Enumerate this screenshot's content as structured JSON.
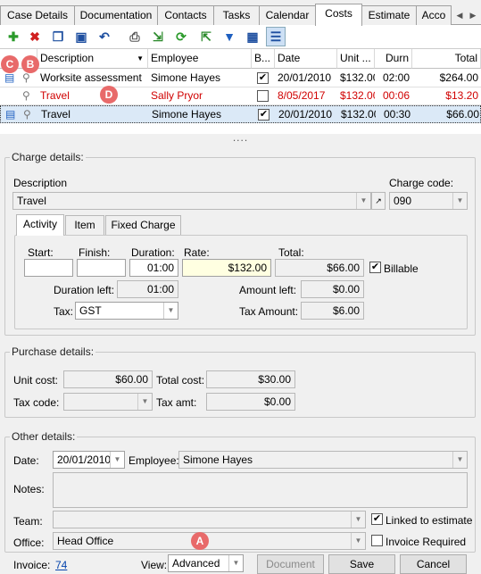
{
  "tabs": [
    "Case Details",
    "Documentation",
    "Contacts",
    "Tasks",
    "Calendar",
    "Costs",
    "Estimate",
    "Acco"
  ],
  "active_tab": "Costs",
  "toolbar": [
    "add-icon",
    "delete-icon",
    "copy-icon",
    "save-icon",
    "undo-icon",
    "print-icon",
    "export-icon",
    "refresh-icon",
    "import-icon",
    "filter-icon",
    "columns-icon",
    "layout-icon"
  ],
  "grid": {
    "headers": {
      "description": "Description",
      "employee": "Employee",
      "billable": "B...",
      "date": "Date",
      "unit": "Unit ...",
      "durn": "Durn",
      "total": "Total"
    },
    "rows": [
      {
        "description": "Worksite assessment",
        "employee": "Simone Hayes",
        "billable": true,
        "date": "20/01/2010",
        "unit": "$132.00",
        "durn": "02:00",
        "total": "$264.00",
        "red": false,
        "selected": false
      },
      {
        "description": "Travel",
        "employee": "Sally Pryor",
        "billable": false,
        "date": "8/05/2017",
        "unit": "$132.00",
        "durn": "00:06",
        "total": "$13.20",
        "red": true,
        "selected": false
      },
      {
        "description": "Travel",
        "employee": "Simone Hayes",
        "billable": true,
        "date": "20/01/2010",
        "unit": "$132.00",
        "durn": "00:30",
        "total": "$66.00",
        "red": false,
        "selected": true
      }
    ]
  },
  "badges": {
    "a": "A",
    "b": "B",
    "c": "C",
    "d": "D"
  },
  "splitter": "....",
  "charge": {
    "group_label": "Charge details:",
    "description_label": "Description",
    "description_value": "Travel",
    "charge_code_label": "Charge code:",
    "charge_code_value": "090",
    "inner_tabs": [
      "Activity",
      "Item",
      "Fixed Charge"
    ],
    "start_label": "Start:",
    "finish_label": "Finish:",
    "duration_label": "Duration:",
    "rate_label": "Rate:",
    "total_label": "Total:",
    "start_value": "",
    "finish_value": "",
    "duration_value": "01:00",
    "rate_value": "$132.00",
    "total_value": "$66.00",
    "billable_label": "Billable",
    "billable": true,
    "duration_left_label": "Duration left:",
    "duration_left_value": "01:00",
    "amount_left_label": "Amount left:",
    "amount_left_value": "$0.00",
    "tax_label": "Tax:",
    "tax_value": "GST",
    "tax_amount_label": "Tax Amount:",
    "tax_amount_value": "$6.00"
  },
  "purchase": {
    "group_label": "Purchase details:",
    "unit_cost_label": "Unit cost:",
    "unit_cost_value": "$60.00",
    "total_cost_label": "Total cost:",
    "total_cost_value": "$30.00",
    "tax_code_label": "Tax code:",
    "tax_code_value": "",
    "tax_amt_label": "Tax amt:",
    "tax_amt_value": "$0.00"
  },
  "other": {
    "group_label": "Other details:",
    "date_label": "Date:",
    "date_value": "20/01/2010",
    "employee_label": "Employee:",
    "employee_value": "Simone Hayes",
    "notes_label": "Notes:",
    "notes_value": "",
    "team_label": "Team:",
    "team_value": "",
    "linked_label": "Linked to estimate",
    "linked": true,
    "office_label": "Office:",
    "office_value": "Head Office",
    "invoice_required_label": "Invoice Required",
    "invoice_required": false
  },
  "footer": {
    "invoice_label": "Invoice:",
    "invoice_value": "74",
    "view_label": "View:",
    "view_value": "Advanced",
    "document_button": "Document",
    "save_button": "Save",
    "cancel_button": "Cancel"
  }
}
